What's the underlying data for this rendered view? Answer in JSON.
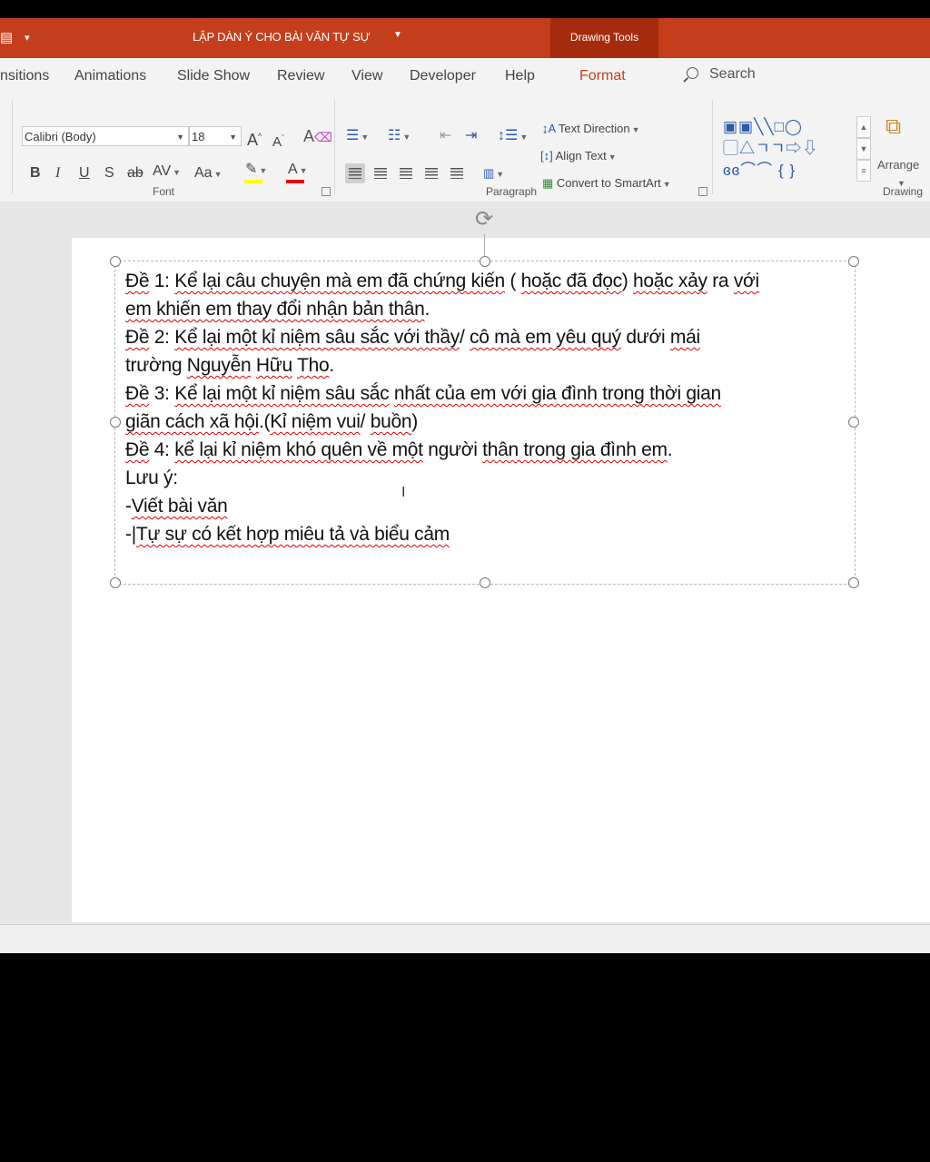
{
  "title_bar": {
    "document_title": "LẬP DÀN Ý CHO BÀI VĂN TỰ SỰ",
    "contextual_tab": "Drawing Tools"
  },
  "tabs": [
    "nsitions",
    "Animations",
    "Slide Show",
    "Review",
    "View",
    "Developer",
    "Help",
    "Format"
  ],
  "active_tab": "Format",
  "search": {
    "label": "Search"
  },
  "ribbon": {
    "font": {
      "group_label": "Font",
      "font_name": "Calibri (Body)",
      "font_size": "18",
      "grow": "A",
      "shrink": "A",
      "bold": "B",
      "italic": "I",
      "underline": "U",
      "shadow": "S",
      "strike": "ab",
      "spacing": "AV",
      "case": "Aa",
      "font_color_letter": "A",
      "highlight_color": "#ffff00",
      "font_color": "#e00000"
    },
    "paragraph": {
      "group_label": "Paragraph",
      "text_direction": "Text Direction",
      "align_text": "Align Text",
      "convert_smartart": "Convert to SmartArt"
    },
    "drawing": {
      "group_label": "Drawing",
      "arrange": "Arrange"
    }
  },
  "slide": {
    "lines": [
      [
        {
          "t": "Đề",
          "s": 1
        },
        {
          "t": " 1: ",
          "s": 0
        },
        {
          "t": "Kể lại câu chuyện mà em đã chứng kiến",
          "s": 1
        },
        {
          "t": " ( ",
          "s": 0
        },
        {
          "t": "hoặc đã đọc",
          "s": 1
        },
        {
          "t": ") ",
          "s": 0
        },
        {
          "t": "hoặc xảy",
          "s": 1
        },
        {
          "t": " ra ",
          "s": 0
        },
        {
          "t": "với",
          "s": 1
        }
      ],
      [
        {
          "t": "em khiến em thay đổi nhận bản thân",
          "s": 1
        },
        {
          "t": ".",
          "s": 0
        }
      ],
      [
        {
          "t": "Đề",
          "s": 1
        },
        {
          "t": " 2: ",
          "s": 0
        },
        {
          "t": "Kể lại một kỉ niệm sâu sắc với thầy",
          "s": 1
        },
        {
          "t": "/ ",
          "s": 0
        },
        {
          "t": "cô mà em yêu quý",
          "s": 1
        },
        {
          "t": " dưới ",
          "s": 0
        },
        {
          "t": "mái",
          "s": 1
        }
      ],
      [
        {
          "t": "trường",
          "s": 0
        },
        {
          "t": " ",
          "s": 0
        },
        {
          "t": "Nguyễn",
          "s": 1
        },
        {
          "t": "  ",
          "s": 0
        },
        {
          "t": "Hữu",
          "s": 1
        },
        {
          "t": " ",
          "s": 0
        },
        {
          "t": "Tho",
          "s": 1
        },
        {
          "t": ".",
          "s": 0
        }
      ],
      [
        {
          "t": "Đề",
          "s": 1
        },
        {
          "t": " 3: ",
          "s": 0
        },
        {
          "t": "Kể lại một kỉ niệm sâu sắc",
          "s": 1
        },
        {
          "t": "  ",
          "s": 0
        },
        {
          "t": "nhất của em với gia đình trong thời gian",
          "s": 1
        }
      ],
      [
        {
          "t": "giãn cách xã hội",
          "s": 1
        },
        {
          "t": ".(",
          "s": 0
        },
        {
          "t": "Kỉ niệm vui",
          "s": 1
        },
        {
          "t": "/ ",
          "s": 0
        },
        {
          "t": "buồn",
          "s": 1
        },
        {
          "t": ")",
          "s": 0
        }
      ],
      [
        {
          "t": "Đề",
          "s": 1
        },
        {
          "t": " 4: ",
          "s": 0
        },
        {
          "t": "kể lại kỉ niệm khó quên về một",
          "s": 1
        },
        {
          "t": " người ",
          "s": 0
        },
        {
          "t": "thân trong gia đình em",
          "s": 1
        },
        {
          "t": ".",
          "s": 0
        }
      ],
      [
        {
          "t": "Lưu ý:",
          "s": 0
        }
      ],
      [
        {
          "t": "-",
          "s": 0
        },
        {
          "t": "Viết bài văn",
          "s": 1
        }
      ],
      [
        {
          "t": " -|",
          "s": 0
        },
        {
          "t": "Tự sự có kết hợp miêu tả và biểu cảm",
          "s": 1
        }
      ]
    ]
  }
}
